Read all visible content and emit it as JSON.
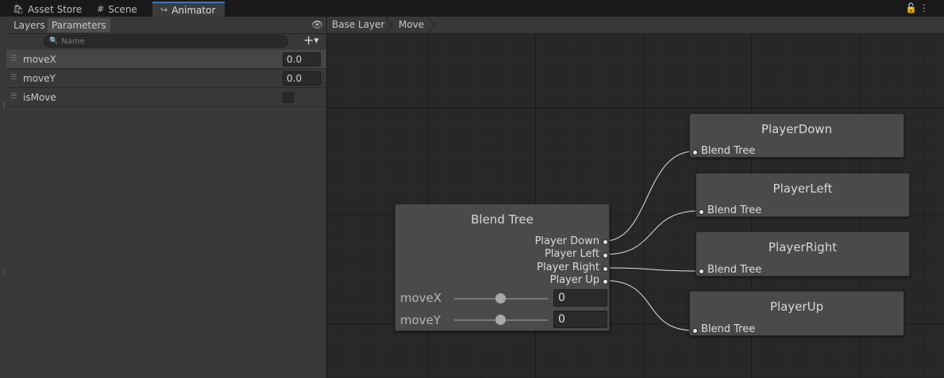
{
  "tabs": [
    {
      "label": "Asset Store",
      "icon": "shopping-bag-icon"
    },
    {
      "label": "Scene",
      "icon": "grid-icon"
    },
    {
      "label": "Animator",
      "icon": "animator-icon",
      "active": true
    }
  ],
  "panel": {
    "tabs": [
      {
        "label": "Layers"
      },
      {
        "label": "Parameters",
        "active": true
      }
    ],
    "search_placeholder": "Name",
    "parameters": [
      {
        "name": "moveX",
        "type": "float",
        "value": "0.0"
      },
      {
        "name": "moveY",
        "type": "float",
        "value": "0.0"
      },
      {
        "name": "isMove",
        "type": "bool",
        "value": false
      }
    ]
  },
  "breadcrumb": [
    "Base Layer",
    "Move"
  ],
  "blend_tree": {
    "title": "Blend Tree",
    "outputs": [
      "Player Down",
      "Player Left",
      "Player Right",
      "Player Up"
    ],
    "params": [
      {
        "label": "moveX",
        "value": "0"
      },
      {
        "label": "moveY",
        "value": "0"
      }
    ]
  },
  "motion_nodes": [
    {
      "title": "PlayerDown",
      "port": "Blend Tree"
    },
    {
      "title": "PlayerLeft",
      "port": "Blend Tree"
    },
    {
      "title": "PlayerRight",
      "port": "Blend Tree"
    },
    {
      "title": "PlayerUp",
      "port": "Blend Tree"
    }
  ],
  "colors": {
    "active_tab_accent": "#3a79bb",
    "node_bg": "#4a4a4a",
    "graph_bg": "#282828",
    "link": "#dde3ea"
  }
}
